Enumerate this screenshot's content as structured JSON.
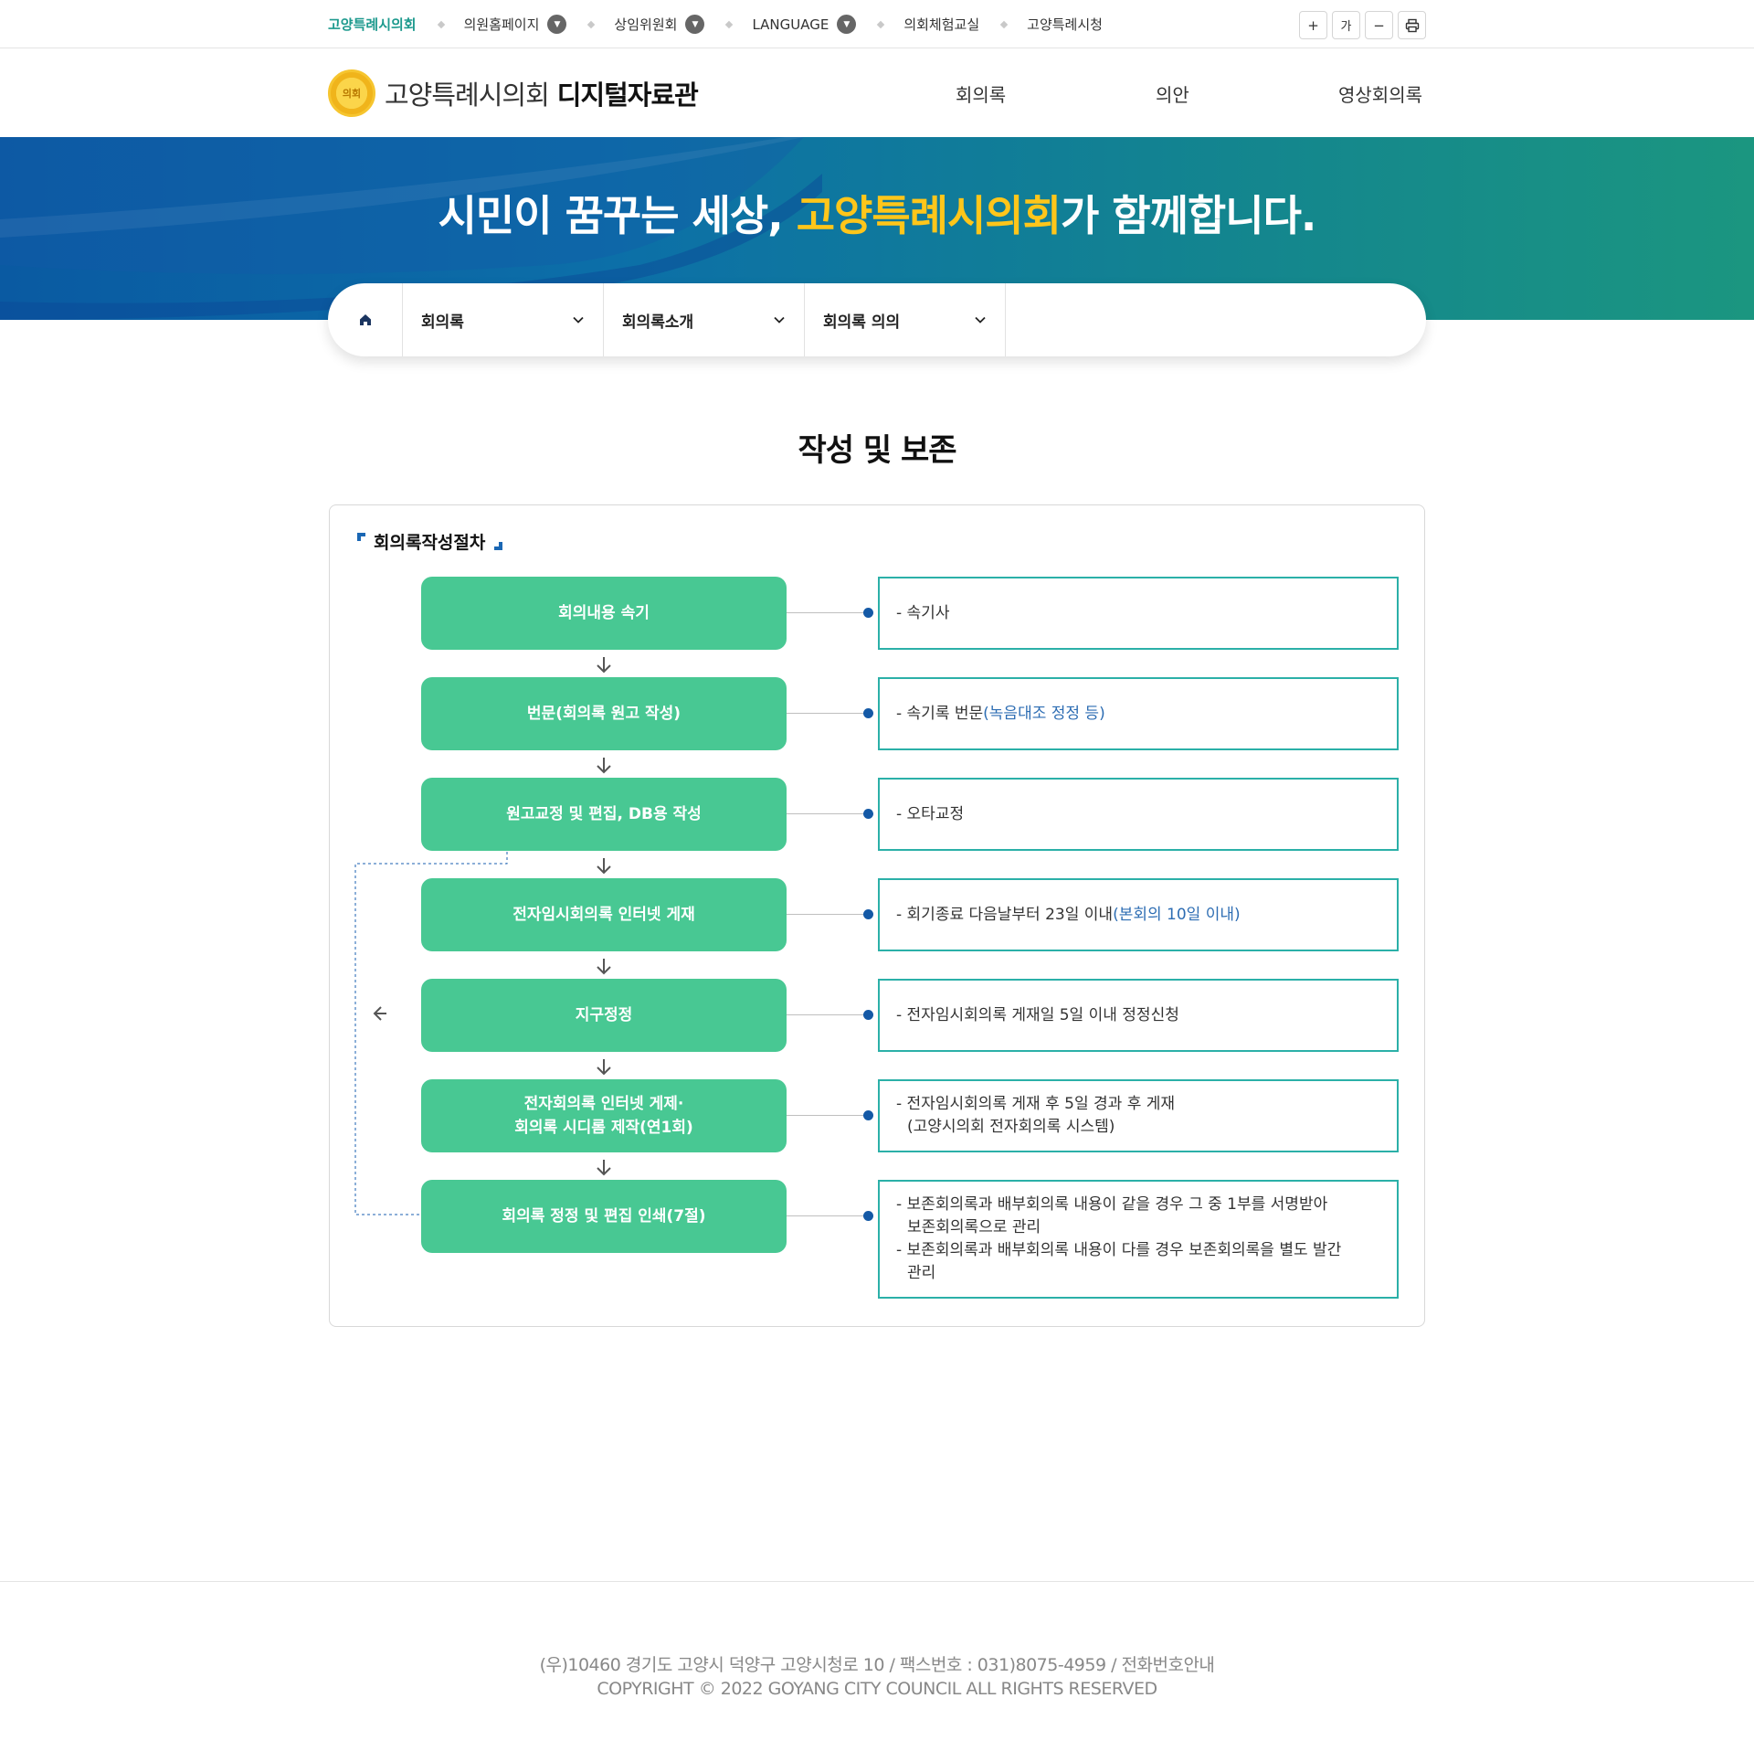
{
  "topbar": {
    "items": [
      {
        "label": "고양특례시의회",
        "has_dropdown": false,
        "active": true
      },
      {
        "label": "의원홈페이지",
        "has_dropdown": true,
        "active": false
      },
      {
        "label": "상임위원회",
        "has_dropdown": true,
        "active": false
      },
      {
        "label": "LANGUAGE",
        "has_dropdown": true,
        "active": false
      },
      {
        "label": "의회체험교실",
        "has_dropdown": false,
        "active": false
      },
      {
        "label": "고양특례시청",
        "has_dropdown": false,
        "active": false
      }
    ],
    "tools": {
      "zoom_in": "+",
      "font": "가",
      "zoom_out": "−",
      "print_icon": "printer-icon"
    }
  },
  "header": {
    "logo_emblem": "의회",
    "logo_name": "고양특례시의회",
    "logo_sub": "디지털자료관",
    "nav": [
      "회의록",
      "의안",
      "영상회의록"
    ]
  },
  "banner": {
    "text_before": "시민이 꿈꾸는 세상, ",
    "text_highlight": "고양특례시의회",
    "text_after": "가 함께합니다.",
    "highlight_color": "#ffc61a"
  },
  "location": {
    "home_icon": "home-icon",
    "items": [
      "회의록",
      "회의록소개",
      "회의록 의의"
    ]
  },
  "page": {
    "title": "작성 및 보존"
  },
  "procedure": {
    "title": "회의록작성절차",
    "steps": [
      {
        "lines": [
          "회의내용 속기"
        ],
        "desc": [
          [
            "- 속기사"
          ]
        ]
      },
      {
        "lines": [
          "번문(회의록 원고 작성)"
        ],
        "desc": [
          [
            "- 속기록 번문",
            "(녹음대조 정정 등)"
          ]
        ]
      },
      {
        "lines": [
          "원고교정 및 편집, DB용 작성"
        ],
        "desc": [
          [
            "- 오타교정"
          ]
        ]
      },
      {
        "lines": [
          "전자임시회의록 인터넷 게재"
        ],
        "desc": [
          [
            "- 회기종료 다음날부터 23일 이내",
            "(본회의 10일 이내)"
          ]
        ]
      },
      {
        "lines": [
          "지구정정"
        ],
        "desc": [
          [
            "- 전자임시회의록 게재일 5일 이내 정정신청"
          ]
        ]
      },
      {
        "lines": [
          "전자회의록 인터넷 게제·",
          "회의록 시디롬 제작(연1회)"
        ],
        "desc": [
          [
            "- 전자임시회의록 게재 후 5일 경과 후 게재"
          ],
          [
            "(고양시의회 전자회의록 시스템)"
          ]
        ]
      },
      {
        "lines": [
          "회의록 정정 및 편집 인쇄(7절)"
        ],
        "desc": [
          [
            "- 보존회의록과 배부회의록 내용이 같을 경우 그 중 1부를 서명받아"
          ],
          [
            "보존회의록으로 관리"
          ],
          [
            "- 보존회의록과 배부회의록 내용이 다를 경우 보존회의록을 별도 발간"
          ],
          [
            "관리"
          ]
        ]
      }
    ],
    "colors": {
      "step": "#48c893",
      "desc_border": "#2bb0a8",
      "dot": "#1459a6",
      "accent": "#2d6db3"
    }
  },
  "footer": {
    "address": "(우)10460 경기도 고양시 덕양구 고양시청로 10 / 팩스번호 : 031)8075-4959 / 전화번호안내",
    "copyright": "COPYRIGHT © 2022 GOYANG CITY COUNCIL ALL RIGHTS RESERVED"
  }
}
